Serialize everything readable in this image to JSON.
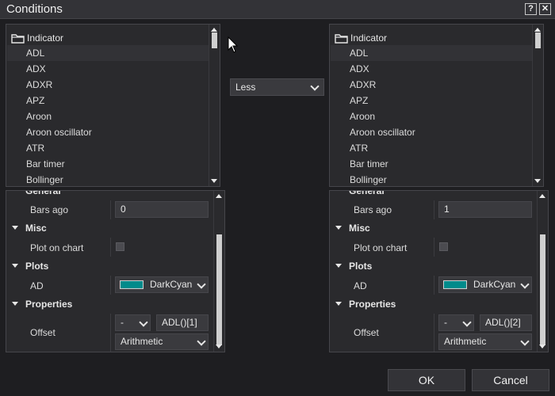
{
  "window": {
    "title": "Conditions",
    "help_label": "?",
    "close_label": "✕"
  },
  "left": {
    "tree": {
      "root_label": "Indicator",
      "items": [
        "ADL",
        "ADX",
        "ADXR",
        "APZ",
        "Aroon",
        "Aroon oscillator",
        "ATR",
        "Bar timer",
        "Bollinger"
      ],
      "selected": "ADL"
    },
    "props": {
      "partial_category": "General",
      "bars_ago_label": "Bars ago",
      "bars_ago_value": "0",
      "misc_label": "Misc",
      "plot_on_chart_label": "Plot on chart",
      "plots_label": "Plots",
      "ad_label": "AD",
      "ad_color_name": "DarkCyan",
      "ad_color_hex": "#008b8b",
      "properties_label": "Properties",
      "offset_label": "Offset",
      "offset_sign": "-",
      "offset_value": "ADL()[1]",
      "offset_type": "Arithmetic"
    }
  },
  "condition": {
    "operator": "Less"
  },
  "right": {
    "tree": {
      "root_label": "Indicator",
      "items": [
        "ADL",
        "ADX",
        "ADXR",
        "APZ",
        "Aroon",
        "Aroon oscillator",
        "ATR",
        "Bar timer",
        "Bollinger"
      ],
      "selected": "ADL"
    },
    "props": {
      "partial_category": "General",
      "bars_ago_label": "Bars ago",
      "bars_ago_value": "1",
      "misc_label": "Misc",
      "plot_on_chart_label": "Plot on chart",
      "plots_label": "Plots",
      "ad_label": "AD",
      "ad_color_name": "DarkCyan",
      "ad_color_hex": "#008b8b",
      "properties_label": "Properties",
      "offset_label": "Offset",
      "offset_sign": "-",
      "offset_value": "ADL()[2]",
      "offset_type": "Arithmetic"
    }
  },
  "buttons": {
    "ok": "OK",
    "cancel": "Cancel"
  }
}
